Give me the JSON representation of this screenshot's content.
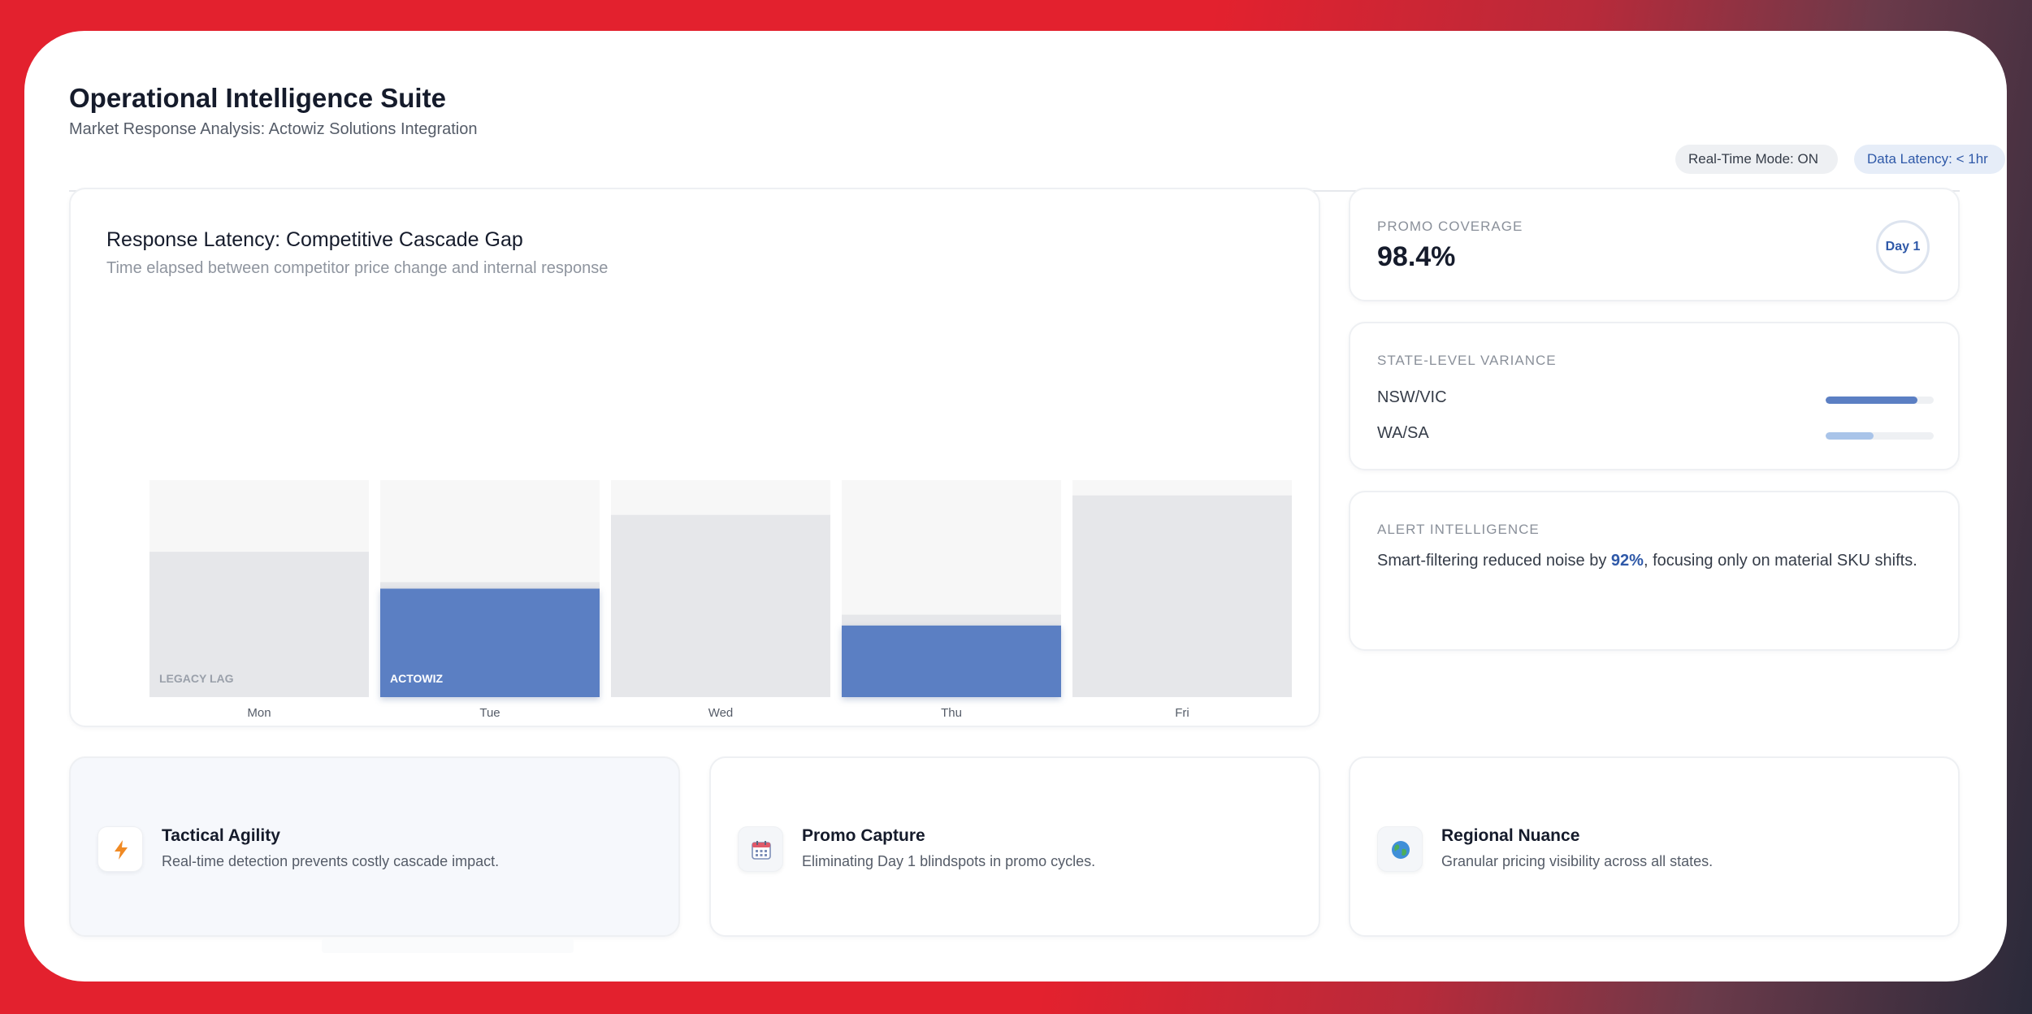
{
  "header": {
    "title": "Operational Intelligence Suite",
    "subtitle": "Market Response Analysis: Actowiz Solutions Integration",
    "realtime_pill": "Real-Time Mode: ON",
    "latency_pill": "Data Latency: < 1hr"
  },
  "chart": {
    "title": "Response Latency: Competitive Cascade Gap",
    "subtitle": "Time elapsed between competitor price change and internal response"
  },
  "chart_data": {
    "type": "bar",
    "title": "Response Latency: Competitive Cascade Gap",
    "subtitle": "Time elapsed between competitor price change and internal response",
    "categories": [
      "Mon",
      "Tue",
      "Wed",
      "Thu",
      "Fri"
    ],
    "series": [
      {
        "name": "LEGACY LAG",
        "values": [
          67,
          53,
          84,
          38,
          93
        ]
      },
      {
        "name": "ACTOWIZ",
        "values": [
          0,
          50,
          0,
          33,
          0
        ]
      }
    ],
    "ylim": [
      0,
      100
    ],
    "grid": false,
    "colors": {
      "legacy": "#e6e7ea",
      "actowiz": "#5b7fc3",
      "track": "#f7f7f7"
    }
  },
  "promo": {
    "label": "PROMO COVERAGE",
    "value": "98.4%",
    "badge": "Day 1"
  },
  "variance": {
    "label": "STATE-LEVEL VARIANCE",
    "rows": [
      {
        "name": "NSW/VIC",
        "fill": 0.85,
        "color": "#5b7fc3"
      },
      {
        "name": "WA/SA",
        "fill": 0.44,
        "color": "#a9c4e9"
      }
    ]
  },
  "alert": {
    "label": "ALERT INTELLIGENCE",
    "text_before": "Smart-filtering reduced noise by ",
    "highlight": "92%",
    "text_after": ", focusing only on material SKU shifts."
  },
  "features": [
    {
      "title": "Tactical Agility",
      "desc": "Real-time detection prevents costly cascade impact.",
      "icon": "lightning-icon"
    },
    {
      "title": "Promo Capture",
      "desc": "Eliminating Day 1 blindspots in promo cycles.",
      "icon": "calendar-icon"
    },
    {
      "title": "Regional Nuance",
      "desc": "Granular pricing visibility across all states.",
      "icon": "globe-icon"
    }
  ],
  "colors": {
    "accent": "#2f59a8",
    "bar_blue": "#5b7fc3",
    "frame_red": "#e3212e"
  }
}
